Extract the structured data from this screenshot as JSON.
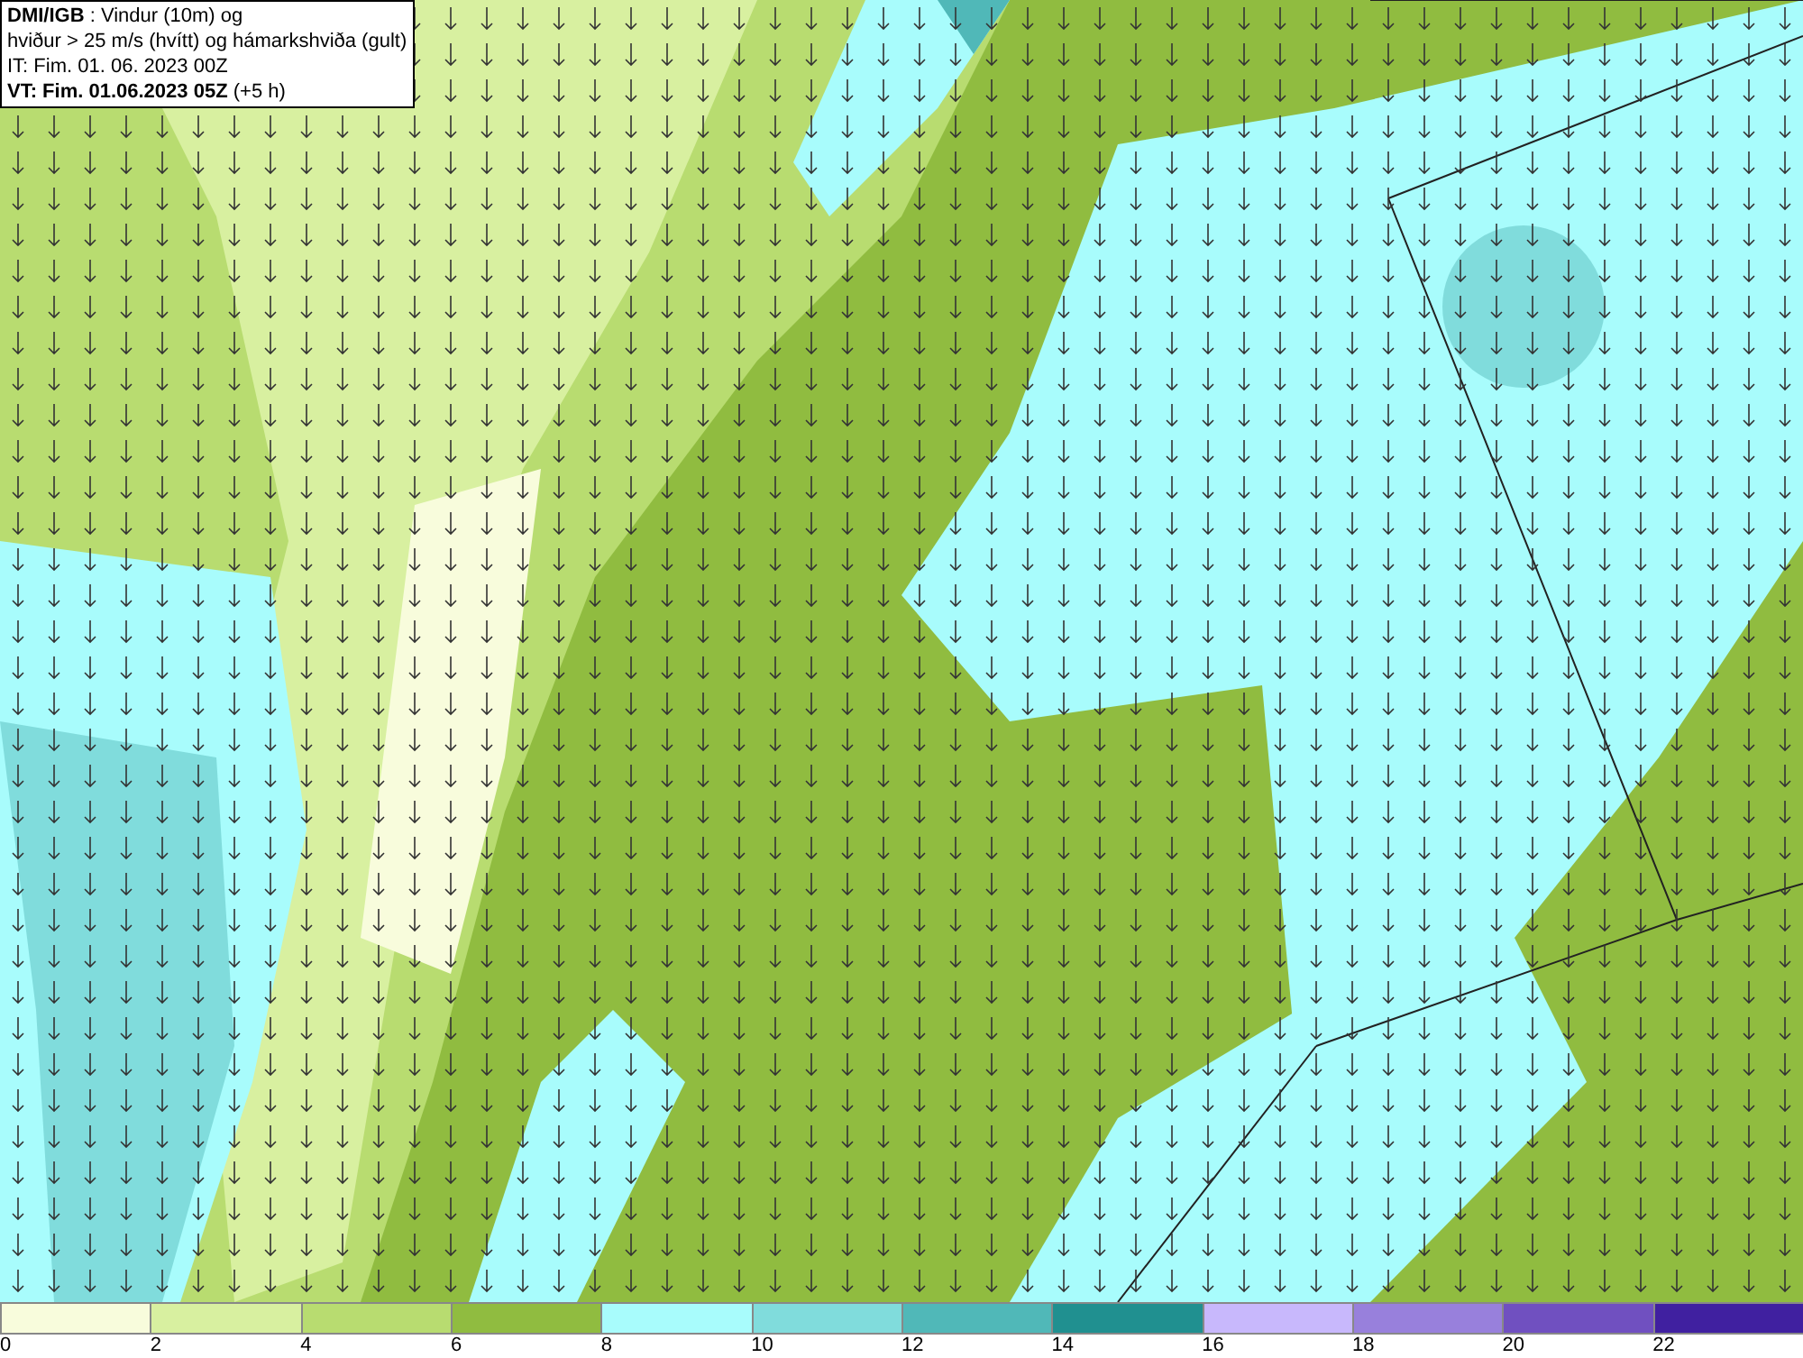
{
  "header": {
    "lines": [
      "**DMI/IGB** : Vindur (10m) og",
      "hviður > 25 m/s (hvítt) og hámarkshviða (gult)",
      "IT: Fim. 01. 06. 2023 00Z",
      "**VT: Fim. 01.06.2023 05Z** (+5 h)"
    ]
  },
  "legend": {
    "items": [
      {
        "label": "0",
        "color": "#f8fcdc"
      },
      {
        "label": "2",
        "color": "#d8f0a0"
      },
      {
        "label": "4",
        "color": "#b8dc70"
      },
      {
        "label": "6",
        "color": "#90bc40"
      },
      {
        "label": "8",
        "color": "#a8fcfc"
      },
      {
        "label": "10",
        "color": "#80dcdc"
      },
      {
        "label": "12",
        "color": "#50b8b8"
      },
      {
        "label": "14",
        "color": "#209090"
      },
      {
        "label": "16",
        "color": "#c8b8fc"
      },
      {
        "label": "18",
        "color": "#9880dc"
      },
      {
        "label": "20",
        "color": "#7050c0"
      },
      {
        "label": "22",
        "color": "#4020a0"
      }
    ]
  }
}
